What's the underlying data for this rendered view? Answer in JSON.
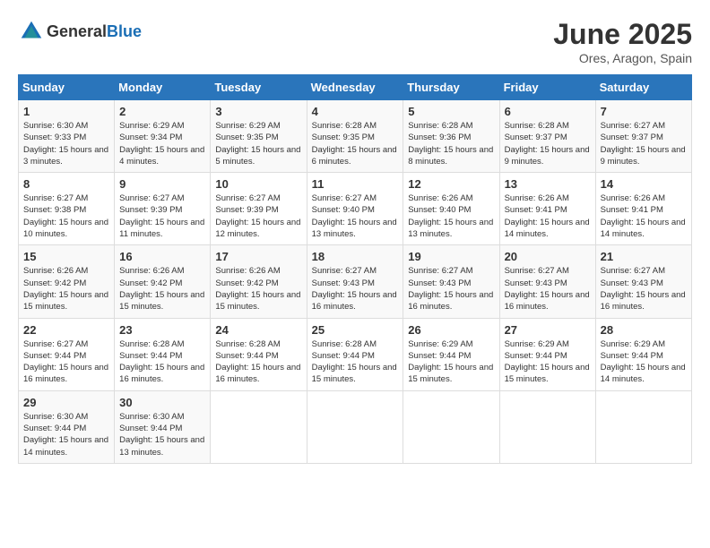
{
  "header": {
    "logo_general": "General",
    "logo_blue": "Blue",
    "month_year": "June 2025",
    "location": "Ores, Aragon, Spain"
  },
  "days_of_week": [
    "Sunday",
    "Monday",
    "Tuesday",
    "Wednesday",
    "Thursday",
    "Friday",
    "Saturday"
  ],
  "weeks": [
    [
      {
        "day": "1",
        "sunrise": "Sunrise: 6:30 AM",
        "sunset": "Sunset: 9:33 PM",
        "daylight": "Daylight: 15 hours and 3 minutes."
      },
      {
        "day": "2",
        "sunrise": "Sunrise: 6:29 AM",
        "sunset": "Sunset: 9:34 PM",
        "daylight": "Daylight: 15 hours and 4 minutes."
      },
      {
        "day": "3",
        "sunrise": "Sunrise: 6:29 AM",
        "sunset": "Sunset: 9:35 PM",
        "daylight": "Daylight: 15 hours and 5 minutes."
      },
      {
        "day": "4",
        "sunrise": "Sunrise: 6:28 AM",
        "sunset": "Sunset: 9:35 PM",
        "daylight": "Daylight: 15 hours and 6 minutes."
      },
      {
        "day": "5",
        "sunrise": "Sunrise: 6:28 AM",
        "sunset": "Sunset: 9:36 PM",
        "daylight": "Daylight: 15 hours and 8 minutes."
      },
      {
        "day": "6",
        "sunrise": "Sunrise: 6:28 AM",
        "sunset": "Sunset: 9:37 PM",
        "daylight": "Daylight: 15 hours and 9 minutes."
      },
      {
        "day": "7",
        "sunrise": "Sunrise: 6:27 AM",
        "sunset": "Sunset: 9:37 PM",
        "daylight": "Daylight: 15 hours and 9 minutes."
      }
    ],
    [
      {
        "day": "8",
        "sunrise": "Sunrise: 6:27 AM",
        "sunset": "Sunset: 9:38 PM",
        "daylight": "Daylight: 15 hours and 10 minutes."
      },
      {
        "day": "9",
        "sunrise": "Sunrise: 6:27 AM",
        "sunset": "Sunset: 9:39 PM",
        "daylight": "Daylight: 15 hours and 11 minutes."
      },
      {
        "day": "10",
        "sunrise": "Sunrise: 6:27 AM",
        "sunset": "Sunset: 9:39 PM",
        "daylight": "Daylight: 15 hours and 12 minutes."
      },
      {
        "day": "11",
        "sunrise": "Sunrise: 6:27 AM",
        "sunset": "Sunset: 9:40 PM",
        "daylight": "Daylight: 15 hours and 13 minutes."
      },
      {
        "day": "12",
        "sunrise": "Sunrise: 6:26 AM",
        "sunset": "Sunset: 9:40 PM",
        "daylight": "Daylight: 15 hours and 13 minutes."
      },
      {
        "day": "13",
        "sunrise": "Sunrise: 6:26 AM",
        "sunset": "Sunset: 9:41 PM",
        "daylight": "Daylight: 15 hours and 14 minutes."
      },
      {
        "day": "14",
        "sunrise": "Sunrise: 6:26 AM",
        "sunset": "Sunset: 9:41 PM",
        "daylight": "Daylight: 15 hours and 14 minutes."
      }
    ],
    [
      {
        "day": "15",
        "sunrise": "Sunrise: 6:26 AM",
        "sunset": "Sunset: 9:42 PM",
        "daylight": "Daylight: 15 hours and 15 minutes."
      },
      {
        "day": "16",
        "sunrise": "Sunrise: 6:26 AM",
        "sunset": "Sunset: 9:42 PM",
        "daylight": "Daylight: 15 hours and 15 minutes."
      },
      {
        "day": "17",
        "sunrise": "Sunrise: 6:26 AM",
        "sunset": "Sunset: 9:42 PM",
        "daylight": "Daylight: 15 hours and 15 minutes."
      },
      {
        "day": "18",
        "sunrise": "Sunrise: 6:27 AM",
        "sunset": "Sunset: 9:43 PM",
        "daylight": "Daylight: 15 hours and 16 minutes."
      },
      {
        "day": "19",
        "sunrise": "Sunrise: 6:27 AM",
        "sunset": "Sunset: 9:43 PM",
        "daylight": "Daylight: 15 hours and 16 minutes."
      },
      {
        "day": "20",
        "sunrise": "Sunrise: 6:27 AM",
        "sunset": "Sunset: 9:43 PM",
        "daylight": "Daylight: 15 hours and 16 minutes."
      },
      {
        "day": "21",
        "sunrise": "Sunrise: 6:27 AM",
        "sunset": "Sunset: 9:43 PM",
        "daylight": "Daylight: 15 hours and 16 minutes."
      }
    ],
    [
      {
        "day": "22",
        "sunrise": "Sunrise: 6:27 AM",
        "sunset": "Sunset: 9:44 PM",
        "daylight": "Daylight: 15 hours and 16 minutes."
      },
      {
        "day": "23",
        "sunrise": "Sunrise: 6:28 AM",
        "sunset": "Sunset: 9:44 PM",
        "daylight": "Daylight: 15 hours and 16 minutes."
      },
      {
        "day": "24",
        "sunrise": "Sunrise: 6:28 AM",
        "sunset": "Sunset: 9:44 PM",
        "daylight": "Daylight: 15 hours and 16 minutes."
      },
      {
        "day": "25",
        "sunrise": "Sunrise: 6:28 AM",
        "sunset": "Sunset: 9:44 PM",
        "daylight": "Daylight: 15 hours and 15 minutes."
      },
      {
        "day": "26",
        "sunrise": "Sunrise: 6:29 AM",
        "sunset": "Sunset: 9:44 PM",
        "daylight": "Daylight: 15 hours and 15 minutes."
      },
      {
        "day": "27",
        "sunrise": "Sunrise: 6:29 AM",
        "sunset": "Sunset: 9:44 PM",
        "daylight": "Daylight: 15 hours and 15 minutes."
      },
      {
        "day": "28",
        "sunrise": "Sunrise: 6:29 AM",
        "sunset": "Sunset: 9:44 PM",
        "daylight": "Daylight: 15 hours and 14 minutes."
      }
    ],
    [
      {
        "day": "29",
        "sunrise": "Sunrise: 6:30 AM",
        "sunset": "Sunset: 9:44 PM",
        "daylight": "Daylight: 15 hours and 14 minutes."
      },
      {
        "day": "30",
        "sunrise": "Sunrise: 6:30 AM",
        "sunset": "Sunset: 9:44 PM",
        "daylight": "Daylight: 15 hours and 13 minutes."
      },
      null,
      null,
      null,
      null,
      null
    ]
  ]
}
